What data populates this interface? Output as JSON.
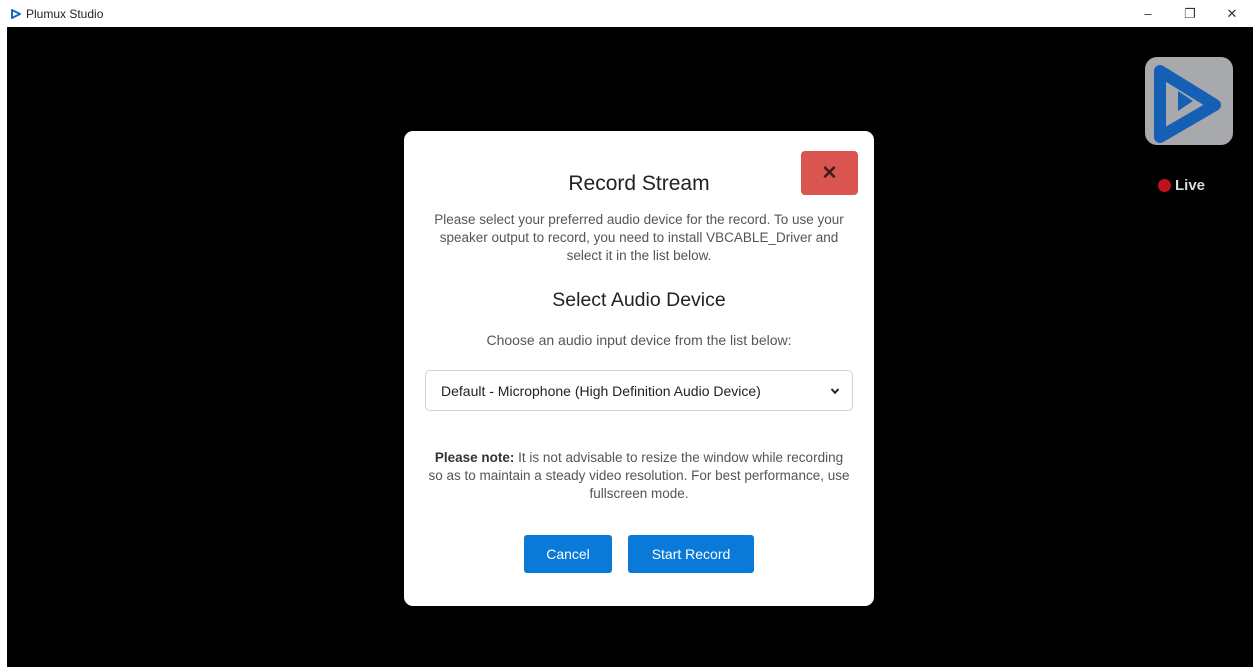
{
  "window": {
    "title": "Plumux Studio",
    "controls": {
      "minimize": "–",
      "restore": "❐",
      "close": "✕"
    }
  },
  "live": {
    "label": "Live",
    "dot_color": "#c0121c"
  },
  "modal": {
    "title": "Record Stream",
    "close_glyph": "✕",
    "intro": "Please select your preferred audio device for the record. To use your speaker output to record, you need to install VBCABLE_Driver and select it in the list below.",
    "section_title": "Select Audio Device",
    "choose_text": "Choose an audio input device from the list below:",
    "select": {
      "value": "Default - Microphone (High Definition Audio Device)"
    },
    "note_label": "Please note:",
    "note_text": " It is not advisable to resize the window while recording so as to maintain a steady video resolution. For best performance, use fullscreen mode.",
    "cancel_label": "Cancel",
    "start_label": "Start Record"
  },
  "colors": {
    "accent": "#0a7ad8",
    "close_button": "#da5450",
    "backdrop": "#000000",
    "logo_blue": "#1560b5"
  },
  "icons": {
    "small_logo": "play-triangle-icon",
    "brand_logo": "plumux-play-logo-icon",
    "select_arrow": "chevron-down-icon"
  }
}
